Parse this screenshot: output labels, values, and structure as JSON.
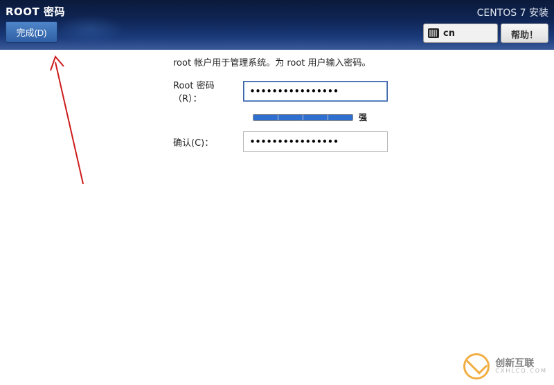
{
  "header": {
    "title": "ROOT 密码",
    "done_label": "完成(D)",
    "install_title": "CENTOS 7 安装",
    "lang_code": "cn",
    "help_label": "帮助！"
  },
  "form": {
    "description": "root 帐户用于管理系统。为 root 用户输入密码。",
    "password_label": "Root 密码（R）：",
    "password_value": "••••••••••••••••",
    "confirm_label": "确认(C)：",
    "confirm_value": "••••••••••••••••",
    "strength_text": "强"
  },
  "watermark": {
    "brand": "创新互联",
    "sub": "CXHLCQ.COM"
  }
}
